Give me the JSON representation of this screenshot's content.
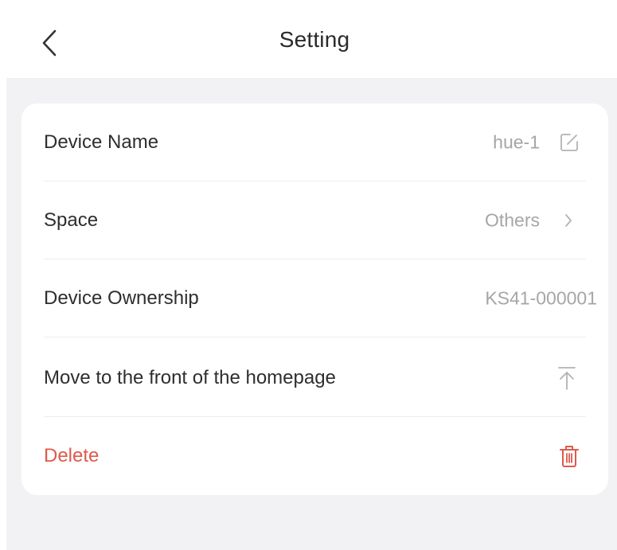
{
  "header": {
    "title": "Setting",
    "back_icon": "chevron-left-icon"
  },
  "settings": {
    "device_name": {
      "label": "Device Name",
      "value": "hue-1",
      "icon": "edit-icon"
    },
    "space": {
      "label": "Space",
      "value": "Others",
      "icon": "chevron-right-icon"
    },
    "device_ownership": {
      "label": "Device Ownership",
      "value": "KS41-000001"
    },
    "move_to_front": {
      "label": "Move to the front of the homepage",
      "icon": "pin-to-top-icon"
    },
    "delete": {
      "label": "Delete",
      "icon": "trash-icon"
    }
  },
  "colors": {
    "background": "#f2f2f4",
    "card": "#ffffff",
    "text_primary": "#2e2e2e",
    "text_secondary": "#a6a6a6",
    "danger": "#dd5a4c",
    "divider": "#ececee"
  }
}
